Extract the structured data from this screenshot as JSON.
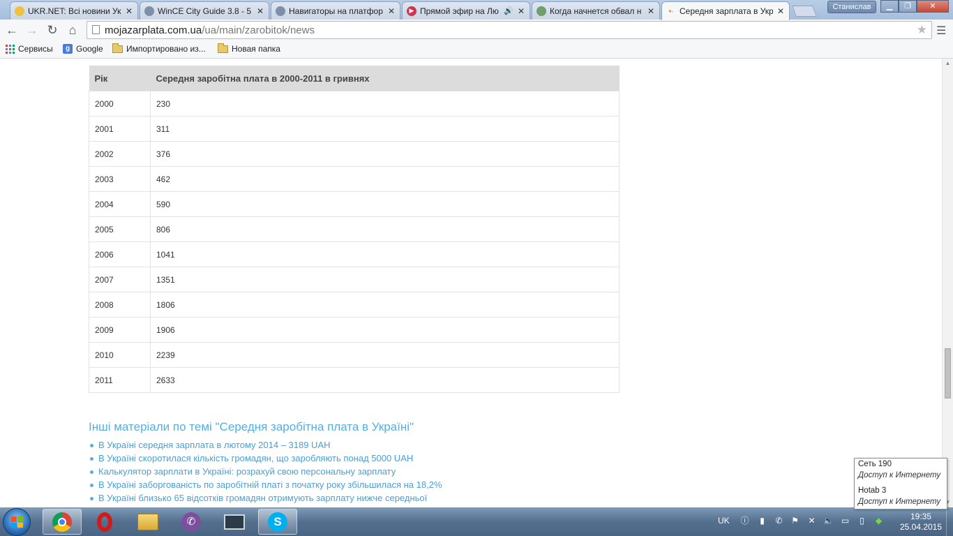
{
  "browser": {
    "tabs": [
      {
        "title": "UKR.NET: Всі новини Укр",
        "icon_color": "#f0c040",
        "active": false
      },
      {
        "title": "WinCE City Guide 3.8 - 5",
        "icon_color": "#7f8fa8",
        "active": false
      },
      {
        "title": "Навигаторы на платфор",
        "icon_color": "#7f8fa8",
        "active": false
      },
      {
        "title": "Прямой эфир на Лю",
        "icon_color": "#d0344f",
        "active": false
      },
      {
        "title": "Когда начнется обвал н",
        "icon_color": "#6da06d",
        "active": false
      },
      {
        "title": "Середня зарплата в Укр",
        "icon_color": "#f08a24",
        "active": true
      }
    ],
    "user_name": "Станислав",
    "url_domain": "mojazarplata.com.ua",
    "url_path": "/ua/main/zarobitok/news",
    "bookmarks": [
      {
        "label": "Сервисы",
        "icon": "apps-grid-icon"
      },
      {
        "label": "Google",
        "icon": "google-icon"
      },
      {
        "label": "Импортировано из...",
        "icon": "folder-icon"
      },
      {
        "label": "Новая папка",
        "icon": "folder-icon"
      }
    ]
  },
  "table": {
    "headers": [
      "Рік",
      "Середня заробітна плата в 2000-2011 в гривнях"
    ],
    "rows": [
      [
        "2000",
        "230"
      ],
      [
        "2001",
        "311"
      ],
      [
        "2002",
        "376"
      ],
      [
        "2003",
        "462"
      ],
      [
        "2004",
        "590"
      ],
      [
        "2005",
        "806"
      ],
      [
        "2006",
        "1041"
      ],
      [
        "2007",
        "1351"
      ],
      [
        "2008",
        "1806"
      ],
      [
        "2009",
        "1906"
      ],
      [
        "2010",
        "2239"
      ],
      [
        "2011",
        "2633"
      ]
    ]
  },
  "more": {
    "heading": "Інші матеріали по темі \"Середня заробітна плата в Україні\"",
    "links": [
      "В Україні середня зарплата в лютому 2014 – 3189 UAH",
      "В Україні скоротилася кількість громадян, що заробляють понад 5000 UAH",
      "Калькулятор зарплати в Україні: розрахуй свою персональну зарплату",
      "В Україні заборгованість по заробітній платі з початку року збільшилася на 18,2%",
      "В Україні близько 65 відсотків громадян отримують зарплату нижче середньої"
    ]
  },
  "network_popup": {
    "items": [
      {
        "name": "Сеть 190",
        "status": "Доступ к Интернету"
      },
      {
        "name": "Hotab  3",
        "status": "Доступ к Интернету"
      }
    ]
  },
  "taskbar": {
    "language": "UK",
    "time": "19:35",
    "date": "25.04.2015"
  }
}
